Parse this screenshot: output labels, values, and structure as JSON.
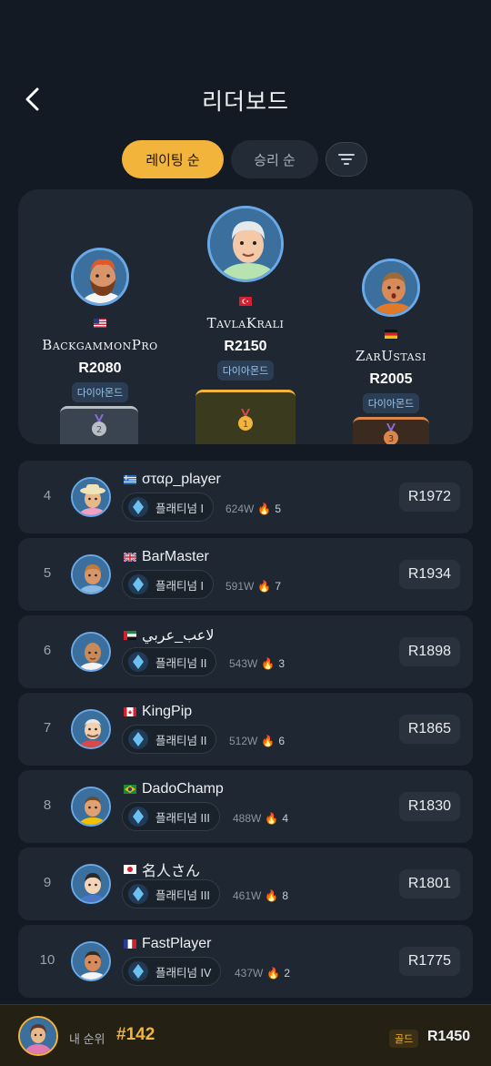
{
  "header": {
    "title": "리더보드"
  },
  "tabs": [
    {
      "label": "레이팅 순",
      "active": true
    },
    {
      "label": "승리 순",
      "active": false
    }
  ],
  "podium": [
    {
      "place": 2,
      "flag": "us",
      "name": "BackgammonPro",
      "rating": "R2080",
      "tier": "다이아몬드",
      "medal": "2"
    },
    {
      "place": 1,
      "flag": "tr",
      "name": "TavlaKrali",
      "rating": "R2150",
      "tier": "다이아몬드",
      "medal": "1"
    },
    {
      "place": 3,
      "flag": "de",
      "name": "ZarUstasi",
      "rating": "R2005",
      "tier": "다이아몬드",
      "medal": "3"
    }
  ],
  "rows": [
    {
      "rank": "4",
      "flag": "gr",
      "name": "σταρ_player",
      "tier": "플래티넘 I",
      "wins": "624W",
      "streak": "5",
      "rating": "R1972"
    },
    {
      "rank": "5",
      "flag": "gb",
      "name": "BarMaster",
      "tier": "플래티넘 I",
      "wins": "591W",
      "streak": "7",
      "rating": "R1934"
    },
    {
      "rank": "6",
      "flag": "ae",
      "name": "لاعب_عربي",
      "tier": "플래티넘 II",
      "wins": "543W",
      "streak": "3",
      "rating": "R1898"
    },
    {
      "rank": "7",
      "flag": "ca",
      "name": "KingPip",
      "tier": "플래티넘 II",
      "wins": "512W",
      "streak": "6",
      "rating": "R1865"
    },
    {
      "rank": "8",
      "flag": "br",
      "name": "DadoChamp",
      "tier": "플래티넘 III",
      "wins": "488W",
      "streak": "4",
      "rating": "R1830"
    },
    {
      "rank": "9",
      "flag": "jp",
      "name": "名人さん",
      "tier": "플래티넘 III",
      "wins": "461W",
      "streak": "8",
      "rating": "R1801"
    },
    {
      "rank": "10",
      "flag": "fr",
      "name": "FastPlayer",
      "tier": "플래티넘 IV",
      "wins": "437W",
      "streak": "2",
      "rating": "R1775"
    }
  ],
  "my_rank": {
    "label": "내 순위",
    "value": "#142",
    "tier": "골드",
    "rating": "R1450"
  },
  "colors": {
    "accent": "#f2b43a",
    "background": "#131a23",
    "card": "#1e2732"
  }
}
